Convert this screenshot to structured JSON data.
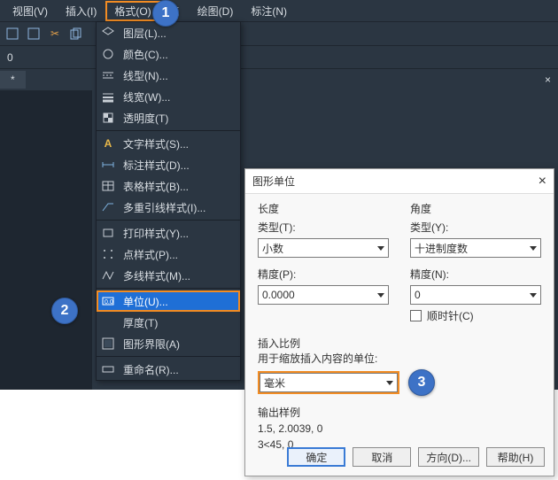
{
  "menubar": {
    "items": [
      {
        "label": "视图(V)"
      },
      {
        "label": "插入(I)"
      },
      {
        "label": "格式(O)",
        "highlight": true
      },
      {
        "label": "工"
      },
      {
        "label": "绘图(D)"
      },
      {
        "label": "标注(N)"
      }
    ]
  },
  "below_toolbar": {
    "text": "0"
  },
  "tabstrip": {
    "tab_label": "*",
    "close": "×"
  },
  "dropdown": {
    "items": [
      {
        "label": "图层(L)..."
      },
      {
        "label": "颜色(C)..."
      },
      {
        "label": "线型(N)..."
      },
      {
        "label": "线宽(W)..."
      },
      {
        "label": "透明度(T)"
      },
      {
        "sep": true
      },
      {
        "label": "文字样式(S)..."
      },
      {
        "label": "标注样式(D)..."
      },
      {
        "label": "表格样式(B)..."
      },
      {
        "label": "多重引线样式(I)..."
      },
      {
        "sep": true
      },
      {
        "label": "打印样式(Y)..."
      },
      {
        "label": "点样式(P)..."
      },
      {
        "label": "多线样式(M)..."
      },
      {
        "sep": true
      },
      {
        "label": "单位(U)...",
        "selected": true,
        "highlight": true
      },
      {
        "label": "厚度(T)"
      },
      {
        "label": "图形界限(A)"
      },
      {
        "sep": true
      },
      {
        "label": "重命名(R)..."
      }
    ]
  },
  "callouts": {
    "c1": "1",
    "c2": "2",
    "c3": "3"
  },
  "dialog": {
    "title": "图形单位",
    "length": {
      "heading": "长度",
      "type_label": "类型(T):",
      "type_value": "小数",
      "precision_label": "精度(P):",
      "precision_value": "0.0000"
    },
    "angle": {
      "heading": "角度",
      "type_label": "类型(Y):",
      "type_value": "十进制度数",
      "precision_label": "精度(N):",
      "precision_value": "0",
      "clockwise_label": "顺时针(C)"
    },
    "insert": {
      "heading": "插入比例",
      "sub": "用于缩放插入内容的单位:",
      "value": "毫米"
    },
    "output": {
      "heading": "输出样例",
      "line1": "1.5, 2.0039, 0",
      "line2": "3<45, 0"
    },
    "buttons": {
      "ok": "确定",
      "cancel": "取消",
      "direction": "方向(D)...",
      "help": "帮助(H)"
    }
  }
}
